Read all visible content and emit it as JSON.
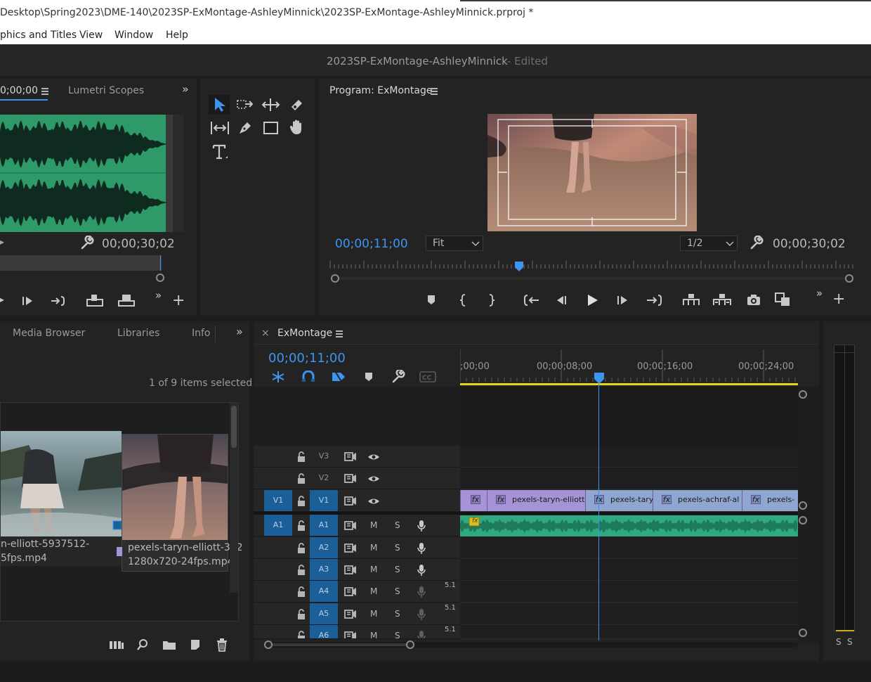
{
  "window": {
    "title": "Desktop\\Spring2023\\DME-140\\2023SP-ExMontage-AshleyMinnick\\2023SP-ExMontage-AshleyMinnick.prproj *"
  },
  "menu": [
    "phics and Titles",
    "View",
    "Window",
    "Help"
  ],
  "app_header": {
    "project": "2023SP-ExMontage-AshleyMinnick",
    "status": "- Edited"
  },
  "source_panel": {
    "tab_timecode": "0;00;00",
    "tab_scopes": "Lumetri Scopes",
    "duration": "00;00;30;02"
  },
  "tools_panel": {
    "tools": [
      "selection-tool",
      "track-select-tool",
      "ripple-edit-tool",
      "razor-tool",
      "slip-tool",
      "pen-tool",
      "rectangle-tool",
      "hand-tool",
      "type-tool"
    ]
  },
  "program_monitor": {
    "tab_label": "Program: ExMontage",
    "current_time": "00;00;11;00",
    "zoom": "Fit",
    "resolution": "1/2",
    "duration": "00;00;30;02"
  },
  "project_panel": {
    "tabs": [
      "Media Browser",
      "Libraries",
      "Info"
    ],
    "selection_status": "1 of 9 items selected",
    "items": [
      {
        "name_line1": "n-elliott-5937512-",
        "name_line2": "5fps.mp4"
      },
      {
        "name_line1": "pexels-taryn-elliott-332",
        "name_line2": "1280x720-24fps.mp4"
      }
    ]
  },
  "timeline": {
    "tab_label": "ExMontage",
    "close_glyph": "×",
    "current_time": "00;00;11;00",
    "ruler": [
      ";00;00",
      "00;00;08;00",
      "00;00;16;00",
      "00;00;24;00"
    ],
    "video_tracks": [
      {
        "name": "V3",
        "target": ""
      },
      {
        "name": "V2",
        "target": ""
      },
      {
        "name": "V1",
        "target": "V1"
      }
    ],
    "audio_tracks": [
      {
        "name": "A1",
        "target": "A1",
        "mute": "M",
        "solo": "S",
        "channels": ""
      },
      {
        "name": "A2",
        "target": "",
        "mute": "M",
        "solo": "S",
        "channels": ""
      },
      {
        "name": "A3",
        "target": "",
        "mute": "M",
        "solo": "S",
        "channels": ""
      },
      {
        "name": "A4",
        "target": "",
        "mute": "M",
        "solo": "S",
        "channels": "5.1"
      },
      {
        "name": "A5",
        "target": "",
        "mute": "M",
        "solo": "S",
        "channels": "5.1"
      },
      {
        "name": "A6",
        "target": "",
        "mute": "M",
        "solo": "S",
        "channels": "5.1"
      }
    ],
    "clips": [
      {
        "label": "fx",
        "name": ""
      },
      {
        "label": "fx",
        "name": "pexels-taryn-elliott-"
      },
      {
        "label": "fx",
        "name": "pexels-tary"
      },
      {
        "label": "fx",
        "name": "pexels-achraf-al"
      },
      {
        "label": "fx",
        "name": "pexels-"
      }
    ],
    "audio_clip_fx": "fx"
  },
  "audio_meter": {
    "solo_labels": [
      "S",
      "S"
    ]
  },
  "colors": {
    "accent_blue": "#3d95f0",
    "clip_video": "#a593d6",
    "clip_audio": "#2ea980",
    "waveform_bg": "#2e9a6a",
    "work_area": "#e8d718"
  }
}
